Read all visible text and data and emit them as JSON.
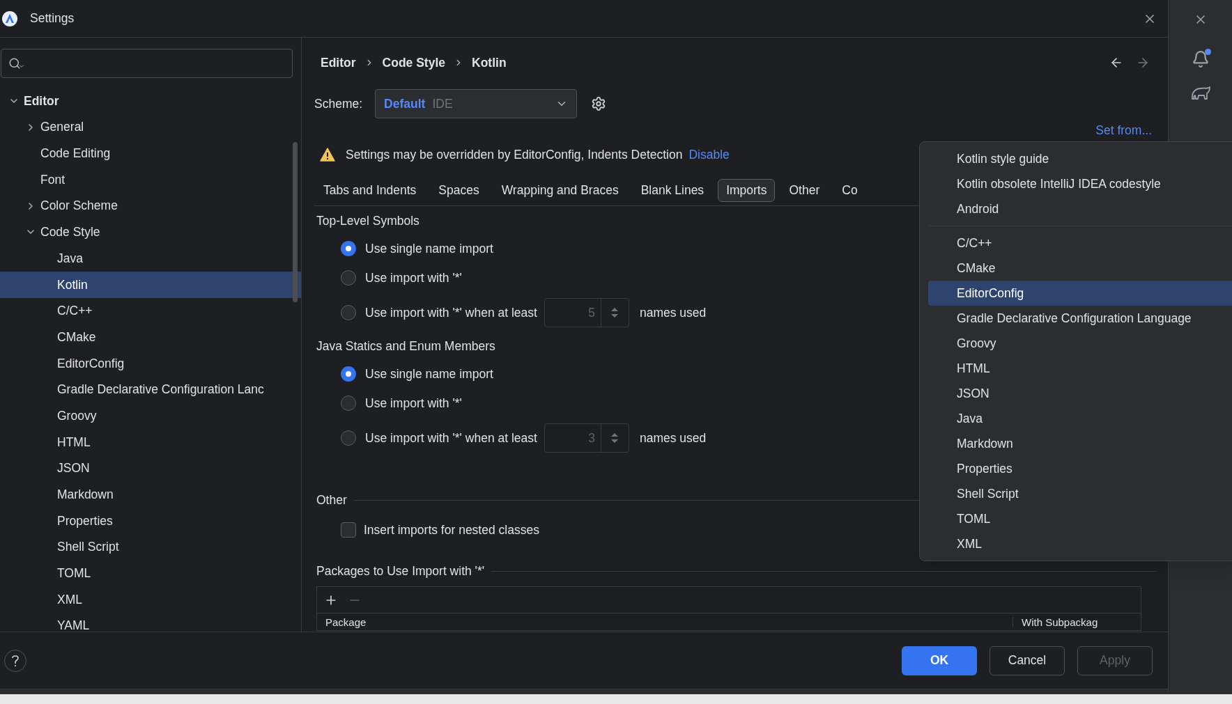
{
  "window": {
    "title": "Settings"
  },
  "sidebar": {
    "tree": [
      {
        "label": "Editor",
        "expanded": true,
        "selected": false,
        "children": [
          {
            "label": "General",
            "expanded": false,
            "selected": false
          },
          {
            "label": "Code Editing",
            "selected": false
          },
          {
            "label": "Font",
            "selected": false
          },
          {
            "label": "Color Scheme",
            "expanded": false,
            "selected": false
          },
          {
            "label": "Code Style",
            "expanded": true,
            "selected": false,
            "children": [
              {
                "label": "Java",
                "selected": false
              },
              {
                "label": "Kotlin",
                "selected": true
              },
              {
                "label": "C/C++",
                "selected": false
              },
              {
                "label": "CMake",
                "selected": false
              },
              {
                "label": "EditorConfig",
                "selected": false
              },
              {
                "label": "Gradle Declarative Configuration Lanc",
                "selected": false
              },
              {
                "label": "Groovy",
                "selected": false
              },
              {
                "label": "HTML",
                "selected": false
              },
              {
                "label": "JSON",
                "selected": false
              },
              {
                "label": "Markdown",
                "selected": false
              },
              {
                "label": "Properties",
                "selected": false
              },
              {
                "label": "Shell Script",
                "selected": false
              },
              {
                "label": "TOML",
                "selected": false
              },
              {
                "label": "XML",
                "selected": false
              },
              {
                "label": "YAML",
                "selected": false
              }
            ]
          }
        ]
      }
    ]
  },
  "breadcrumb": [
    "Editor",
    "Code Style",
    "Kotlin"
  ],
  "scheme": {
    "label": "Scheme:",
    "name": "Default",
    "type": "IDE"
  },
  "set_from": "Set from...",
  "warning": {
    "text": "Settings may be overridden by EditorConfig, Indents Detection",
    "link": "Disable"
  },
  "tabs": [
    {
      "label": "Tabs and Indents",
      "selected": false
    },
    {
      "label": "Spaces",
      "selected": false
    },
    {
      "label": "Wrapping and Braces",
      "selected": false
    },
    {
      "label": "Blank Lines",
      "selected": false
    },
    {
      "label": "Imports",
      "selected": true
    },
    {
      "label": "Other",
      "selected": false
    },
    {
      "label": "Co",
      "selected": false
    }
  ],
  "groups": [
    {
      "title": "Top-Level Symbols",
      "options": [
        {
          "kind": "radio",
          "label": "Use single name import",
          "selected": true
        },
        {
          "kind": "radio",
          "label": "Use import with '*'",
          "selected": false
        },
        {
          "kind": "spinner",
          "label": "Use import with '*' when at least",
          "selected": false,
          "value": "5",
          "disabled": true,
          "suffix": "names used"
        }
      ]
    },
    {
      "title": "Java Statics and Enum Members",
      "options": [
        {
          "kind": "radio",
          "label": "Use single name import",
          "selected": true
        },
        {
          "kind": "radio",
          "label": "Use import with '*'",
          "selected": false
        },
        {
          "kind": "spinner",
          "label": "Use import with '*' when at least",
          "selected": false,
          "value": "3",
          "disabled": true,
          "suffix": "names used"
        }
      ]
    }
  ],
  "other": {
    "title": "Other",
    "checkbox": {
      "label": "Insert imports for nested classes",
      "checked": false
    }
  },
  "packages": {
    "title": "Packages to Use Import with '*'",
    "columns": [
      "Package",
      "With Subpackag"
    ]
  },
  "buttons": [
    {
      "label": "OK",
      "kind": "primary",
      "disabled": false
    },
    {
      "label": "Cancel",
      "kind": "secondary",
      "disabled": false
    },
    {
      "label": "Apply",
      "kind": "secondary",
      "disabled": true
    }
  ],
  "popup": {
    "groups": [
      [
        {
          "label": "Kotlin style guide",
          "selected": false
        },
        {
          "label": "Kotlin obsolete IntelliJ IDEA codestyle",
          "selected": false
        },
        {
          "label": "Android",
          "selected": false
        }
      ],
      [
        {
          "label": "C/C++",
          "selected": false
        },
        {
          "label": "CMake",
          "selected": false
        },
        {
          "label": "EditorConfig",
          "selected": true
        },
        {
          "label": "Gradle Declarative Configuration Language",
          "selected": false
        },
        {
          "label": "Groovy",
          "selected": false
        },
        {
          "label": "HTML",
          "selected": false
        },
        {
          "label": "JSON",
          "selected": false
        },
        {
          "label": "Java",
          "selected": false
        },
        {
          "label": "Markdown",
          "selected": false
        },
        {
          "label": "Properties",
          "selected": false
        },
        {
          "label": "Shell Script",
          "selected": false
        },
        {
          "label": "TOML",
          "selected": false
        },
        {
          "label": "XML",
          "selected": false
        }
      ]
    ]
  }
}
